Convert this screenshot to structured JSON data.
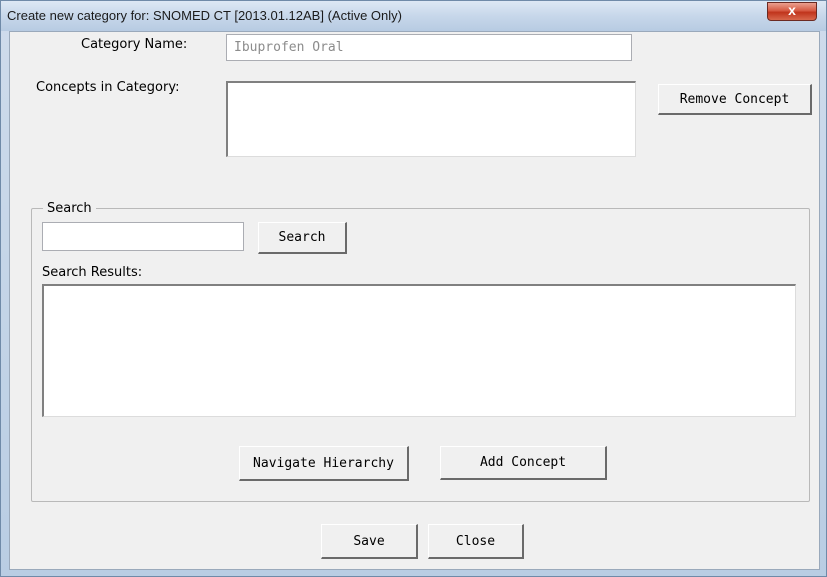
{
  "window": {
    "title": "Create new category for: SNOMED CT [2013.01.12AB] (Active Only)",
    "close_glyph": "x"
  },
  "form": {
    "category_name_label": "Category Name:",
    "category_name_value": "Ibuprofen Oral",
    "concepts_label": "Concepts in Category:",
    "remove_concept_label": "Remove Concept"
  },
  "search": {
    "group_label": "Search",
    "query_value": "",
    "search_button_label": "Search",
    "results_label": "Search Results:",
    "navigate_label": "Navigate Hierarchy",
    "add_concept_label": "Add Concept"
  },
  "footer": {
    "save_label": "Save",
    "close_label": "Close"
  },
  "colors": {
    "title_bar": "#c7d7ea",
    "close_button": "#c9432b",
    "dialog_face": "#f0f0f0"
  },
  "icons": {
    "close": "close-icon"
  }
}
